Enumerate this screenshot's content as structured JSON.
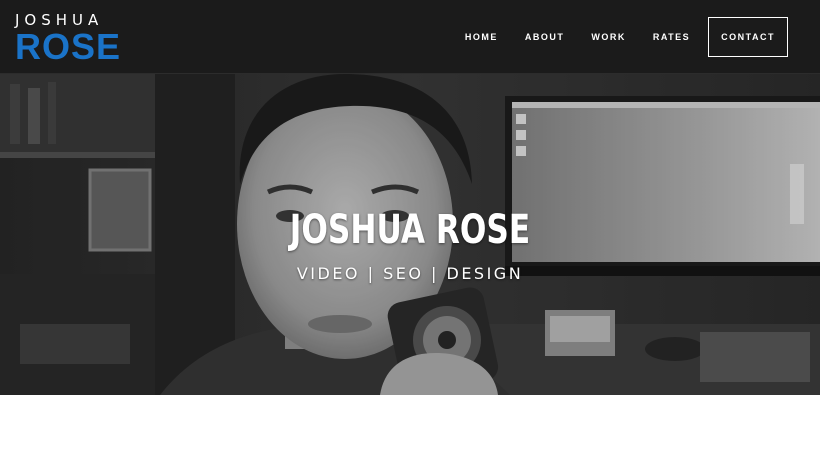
{
  "logo": {
    "top": "JOSHUA",
    "bottom": "ROSE"
  },
  "nav": {
    "items": [
      "HOME",
      "ABOUT",
      "WORK",
      "RATES"
    ],
    "contact": "CONTACT"
  },
  "hero": {
    "title": "JOSHUA ROSE",
    "subtitle": "VIDEO | SEO | DESIGN"
  },
  "colors": {
    "navbar_bg": "#1b1b1b",
    "logo_accent": "#1a73c8",
    "text": "#ffffff"
  }
}
